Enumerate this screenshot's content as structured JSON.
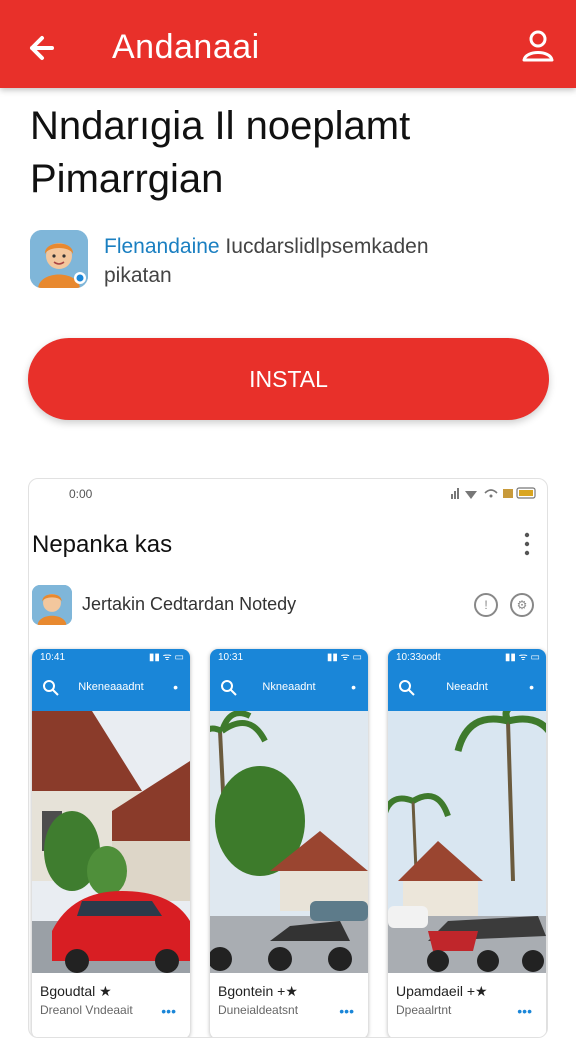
{
  "statusbar": {
    "text": ""
  },
  "appbar": {
    "title": "Andanaai",
    "back_icon": "arrow-left-icon",
    "profile_icon": "user-icon",
    "color": "#e8302a"
  },
  "app": {
    "title_line1": "Nndarıgia Il noeplamt",
    "title_line2": "Pimarrgian",
    "developer_link": "Flenandaine",
    "developer_desc": " Iucdarslidlpsemkaden",
    "developer_desc2": "pikatan"
  },
  "install": {
    "label": "INSTAL"
  },
  "preview": {
    "time": "0:00",
    "title": "Nepanka kas",
    "app_name": "Jertakin Cedtardan Notedy",
    "shots": [
      {
        "time": "10:41",
        "top_title": "Nkeneaaadnt",
        "caption": "Bgoudtal ★",
        "caption2": "Dreanol Vndeaait"
      },
      {
        "time": "10:31",
        "top_title": "Nkneaadnt",
        "caption": "Bgontein +★",
        "caption2": "Duneialdeatsnt"
      },
      {
        "time": "10:33oodt",
        "top_title": "Neeadnt",
        "caption": "Upamdaeil +★",
        "caption2": "Dpeaalrtnt"
      }
    ]
  }
}
